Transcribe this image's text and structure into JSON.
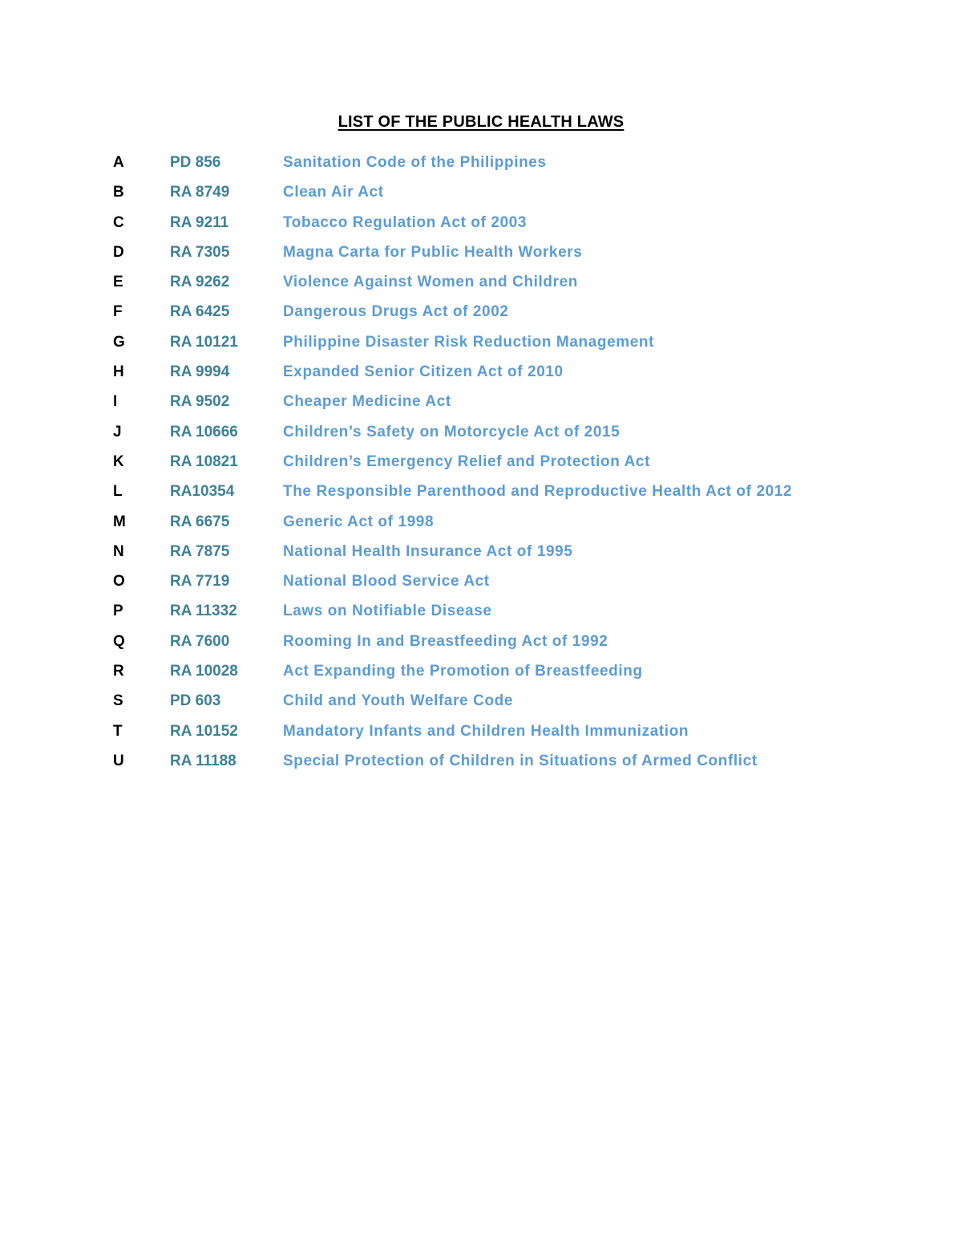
{
  "document": {
    "title": "LIST OF THE PUBLIC HEALTH LAWS",
    "colors": {
      "letter": "#000000",
      "law_number": "#3d8096",
      "law_name": "#5b9bd5"
    },
    "laws": [
      {
        "letter": "A",
        "number": "PD 856",
        "name": "Sanitation Code of the Philippines"
      },
      {
        "letter": "B",
        "number": "RA 8749",
        "name": "Clean Air Act"
      },
      {
        "letter": "C",
        "number": "RA 9211",
        "name": "Tobacco Regulation Act of 2003"
      },
      {
        "letter": "D",
        "number": "RA 7305",
        "name": "Magna Carta for Public Health Workers"
      },
      {
        "letter": "E",
        "number": "RA 9262",
        "name": "Violence Against Women and Children"
      },
      {
        "letter": "F",
        "number": "RA 6425",
        "name": "Dangerous Drugs Act of 2002"
      },
      {
        "letter": "G",
        "number": "RA 10121",
        "name": "Philippine Disaster Risk Reduction Management"
      },
      {
        "letter": "H",
        "number": "RA 9994",
        "name": "Expanded Senior Citizen Act of 2010"
      },
      {
        "letter": "I",
        "number": "RA 9502",
        "name": "Cheaper Medicine Act"
      },
      {
        "letter": "J",
        "number": "RA 10666",
        "name": "Children’s Safety on Motorcycle Act of 2015"
      },
      {
        "letter": "K",
        "number": "RA 10821",
        "name": "Children’s Emergency Relief and Protection Act"
      },
      {
        "letter": "L",
        "number": "RA10354",
        "name": "The Responsible Parenthood and Reproductive Health Act of 2012"
      },
      {
        "letter": "M",
        "number": "RA 6675",
        "name": "Generic Act of 1998"
      },
      {
        "letter": "N",
        "number": "RA 7875",
        "name": "National Health Insurance Act of 1995"
      },
      {
        "letter": "O",
        "number": "RA 7719",
        "name": "National Blood Service Act"
      },
      {
        "letter": "P",
        "number": "RA 11332",
        "name": "Laws on Notifiable Disease"
      },
      {
        "letter": "Q",
        "number": "RA 7600",
        "name": "Rooming In and Breastfeeding Act of 1992"
      },
      {
        "letter": "R",
        "number": "RA 10028",
        "name": "Act Expanding the Promotion of Breastfeeding"
      },
      {
        "letter": "S",
        "number": "PD 603",
        "name": "Child and Youth Welfare Code"
      },
      {
        "letter": "T",
        "number": "RA 10152",
        "name": "Mandatory Infants and Children Health Immunization"
      },
      {
        "letter": "U",
        "number": "RA 11188",
        "name": "Special Protection of Children in Situations of Armed Conflict"
      }
    ]
  }
}
